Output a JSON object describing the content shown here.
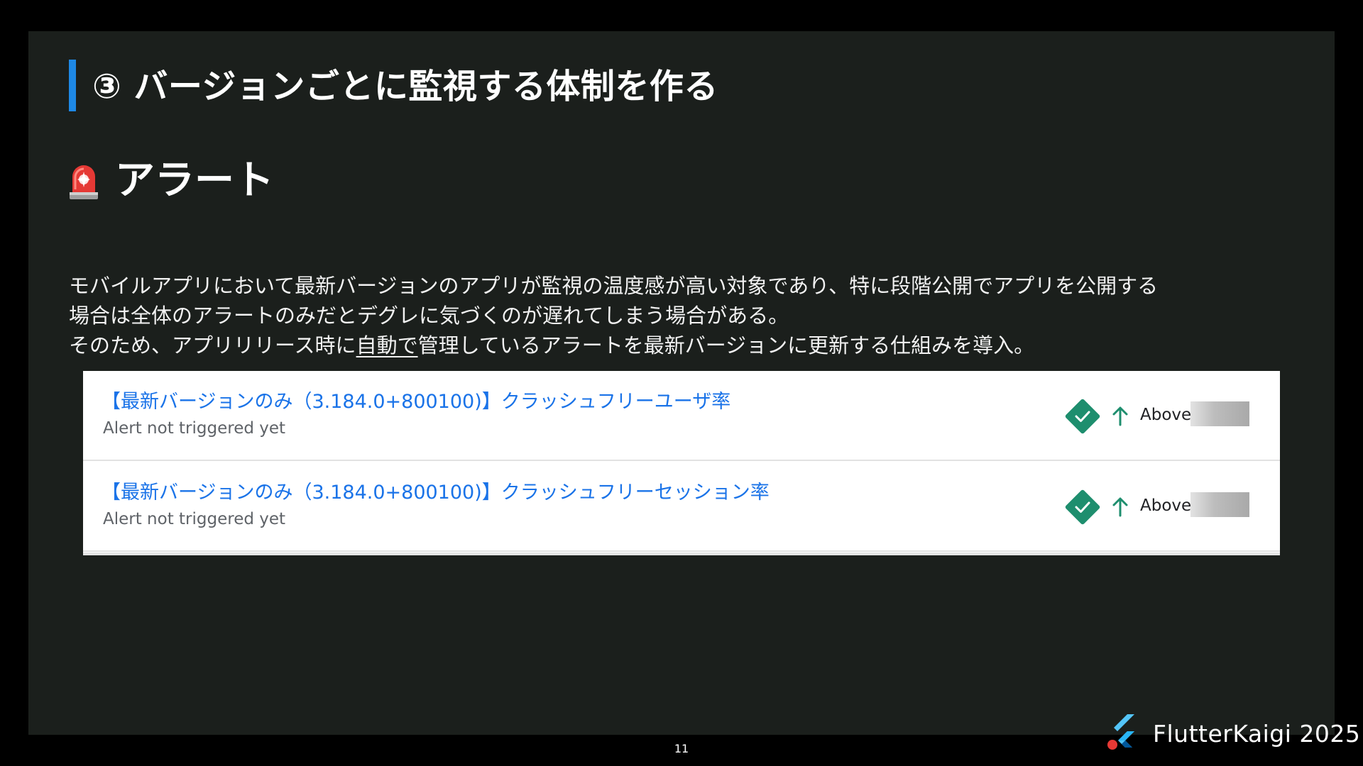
{
  "slide": {
    "title": "③ バージョンごとに監視する体制を作る",
    "section_title": "アラート",
    "description": {
      "line1": "モバイルアプリにおいて最新バージョンのアプリが監視の温度感が高い対象であり、特に段階公開でアプリを公開する",
      "line2": "場合は全体のアラートのみだとデグレに気づくのが遅れてしまう場合がある。",
      "line3_before": "そのため、アプリリリース時に",
      "line3_underlined": "自動で",
      "line3_after": "管理しているアラートを最新バージョンに更新する仕組みを導入。"
    }
  },
  "alerts": [
    {
      "name": "【最新バージョンのみ（3.184.0+800100)】クラッシュフリーユーザ率",
      "status": "Alert not triggered yet",
      "condition": "Above"
    },
    {
      "name": "【最新バージョンのみ（3.184.0+800100)】クラッシュフリーセッション率",
      "status": "Alert not triggered yet",
      "condition": "Above"
    }
  ],
  "footer": {
    "brand": "FlutterKaigi 2025",
    "page_number": "11"
  },
  "colors": {
    "slide_background": "#1b1f1c",
    "title_accent": "#1e88e5",
    "alert_link": "#1a73e8",
    "status_ok": "#1e8e6e"
  },
  "icons": {
    "section": "siren-icon",
    "status": "check-diamond-icon",
    "condition": "arrow-up-icon",
    "brand": "flutter-logo"
  }
}
